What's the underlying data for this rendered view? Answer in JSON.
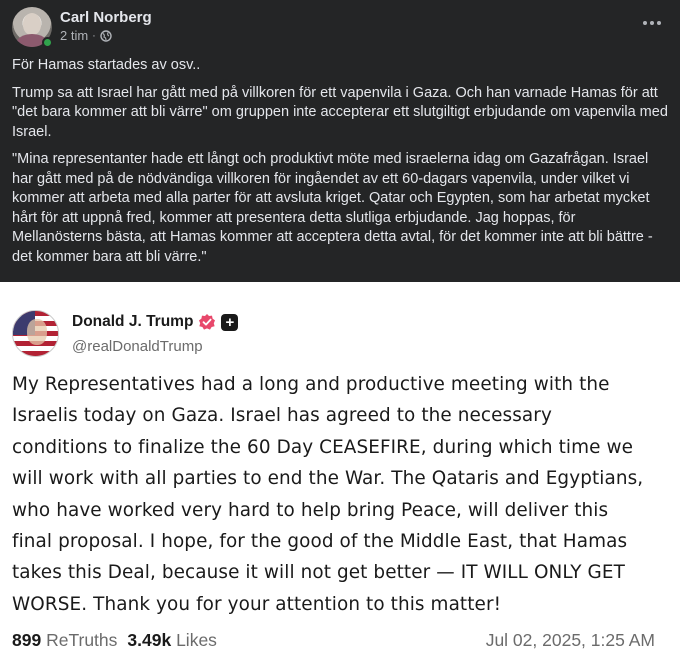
{
  "facebook_post": {
    "author": "Carl Norberg",
    "time": "2 tim",
    "meta_separator": "·",
    "paragraphs": [
      "För Hamas startades av osv..",
      "Trump sa att Israel har gått med på villkoren för ett vapenvila i Gaza. Och han varnade Hamas för att \"det bara kommer att bli värre\" om gruppen inte accepterar ett slutgiltigt erbjudande om vapenvila med Israel.",
      "\"Mina representanter hade ett långt och produktivt möte med israelerna idag om Gazafrågan. Israel har gått med på de nödvändiga villkoren för ingåendet av ett 60-dagars vapenvila, under vilket vi kommer att arbeta med alla parter för att avsluta kriget. Qatar och Egypten, som har arbetat mycket hårt för att uppnå fred, kommer att presentera detta slutliga erbjudande. Jag hoppas, för Mellanösterns bästa, att Hamas kommer att acceptera detta avtal, för det kommer inte att bli bättre - det kommer bara att bli värre.\""
    ],
    "icons": {
      "privacy": "globe-icon",
      "menu": "more-options-icon"
    },
    "online_color": "#31a24c"
  },
  "truth_post": {
    "display_name": "Donald J. Trump",
    "handle": "@realDonaldTrump",
    "badge_plus": "+",
    "text_lines": [
      "My Representatives had a long and productive meeting with the",
      "Israelis today on Gaza. Israel has agreed to the necessary",
      "conditions to finalize the 60 Day CEASEFIRE, during which time we",
      "will work with all parties to end the War. The Qataris and Egyptians,",
      "who have worked very hard to help bring Peace, will deliver this",
      "final proposal. I hope, for the good of the Middle East, that Hamas",
      "takes this Deal, because it will not get better — IT WILL ONLY GET",
      "WORSE. Thank you for your attention to this matter!"
    ],
    "retruths_count": "899",
    "retruths_label": "ReTruths",
    "likes_count": "3.49k",
    "likes_label": "Likes",
    "timestamp": "Jul 02, 2025, 1:25 AM",
    "icons": {
      "verified": "verified-badge-icon",
      "plus": "plus-badge-icon"
    },
    "verified_color": "#e8486b"
  }
}
